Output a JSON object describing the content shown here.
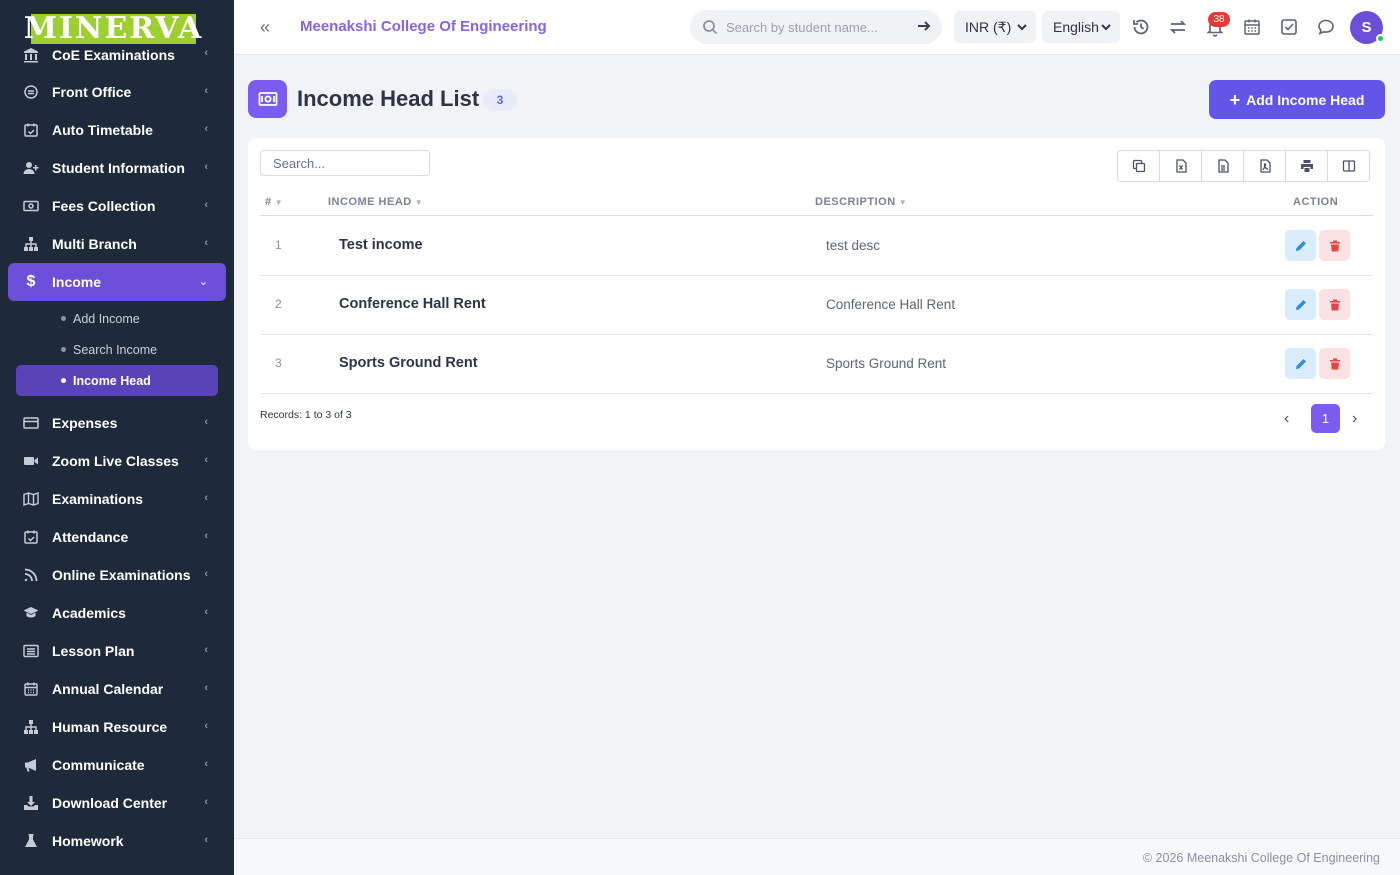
{
  "sidebar": {
    "logo": "MINERVA",
    "items": [
      {
        "label": "CoE Examinations",
        "icon": "bank-icon"
      },
      {
        "label": "Front Office",
        "icon": "front-office-icon"
      },
      {
        "label": "Auto Timetable",
        "icon": "calendar-check-icon"
      },
      {
        "label": "Student Information",
        "icon": "user-add-icon"
      },
      {
        "label": "Fees Collection",
        "icon": "money-icon"
      },
      {
        "label": "Multi Branch",
        "icon": "sitemap-icon"
      },
      {
        "label": "Income",
        "icon": "dollar-icon",
        "active": true,
        "children": [
          {
            "label": "Add Income"
          },
          {
            "label": "Search Income"
          },
          {
            "label": "Income Head",
            "current": true
          }
        ]
      },
      {
        "label": "Expenses",
        "icon": "credit-card-icon"
      },
      {
        "label": "Zoom Live Classes",
        "icon": "video-icon"
      },
      {
        "label": "Examinations",
        "icon": "map-icon"
      },
      {
        "label": "Attendance",
        "icon": "calendar-check-icon"
      },
      {
        "label": "Online Examinations",
        "icon": "rss-icon"
      },
      {
        "label": "Academics",
        "icon": "graduation-cap-icon"
      },
      {
        "label": "Lesson Plan",
        "icon": "list-alt-icon"
      },
      {
        "label": "Annual Calendar",
        "icon": "calendar-icon"
      },
      {
        "label": "Human Resource",
        "icon": "sitemap-icon"
      },
      {
        "label": "Communicate",
        "icon": "bullhorn-icon"
      },
      {
        "label": "Download Center",
        "icon": "download-icon"
      },
      {
        "label": "Homework",
        "icon": "flask-icon"
      }
    ]
  },
  "topbar": {
    "college_name": "Meenakshi College Of Engineering",
    "search_placeholder": "Search by student name...",
    "currency": "INR (₹)",
    "language": "English",
    "notification_count": "38",
    "avatar_initial": "S"
  },
  "page": {
    "title": "Income Head List",
    "count": "3",
    "add_button": "Add Income Head"
  },
  "table": {
    "search_placeholder": "Search...",
    "columns": {
      "num": "#",
      "head": "INCOME HEAD",
      "desc": "DESCRIPTION",
      "action": "ACTION"
    },
    "rows": [
      {
        "num": "1",
        "head": "Test income",
        "desc": "test desc"
      },
      {
        "num": "2",
        "head": "Conference Hall Rent",
        "desc": "Conference Hall Rent"
      },
      {
        "num": "3",
        "head": "Sports Ground Rent",
        "desc": "Sports Ground Rent"
      }
    ],
    "records_text": "Records: 1 to 3 of 3",
    "current_page": "1"
  },
  "footer": {
    "text": "© 2026 Meenakshi College Of Engineering"
  },
  "colors": {
    "sidebar_bg": "#1e2a3a",
    "accent": "#6b4fd8",
    "primary_button": "#6256e8",
    "logo_bg": "#9ccf2f"
  }
}
